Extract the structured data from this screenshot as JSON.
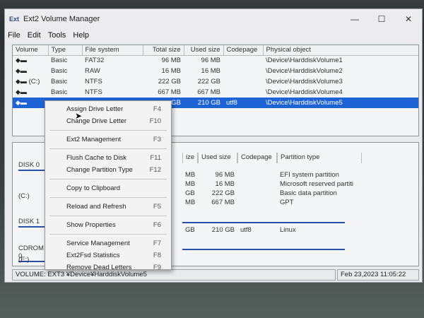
{
  "window": {
    "title": "Ext2 Volume Manager",
    "app_icon": "Ext"
  },
  "window_controls": {
    "minimize": "—",
    "maximize": "☐",
    "close": "✕"
  },
  "menu": [
    "File",
    "Edit",
    "Tools",
    "Help"
  ],
  "volumes": {
    "columns": [
      "Volume",
      "Type",
      "File system",
      "Total size",
      "Used size",
      "Codepage",
      "Physical object"
    ],
    "rows": [
      {
        "volume": "",
        "type": "Basic",
        "fs": "FAT32",
        "total": "96 MB",
        "used": "96 MB",
        "codepage": "",
        "object": "\\Device\\HarddiskVolume1"
      },
      {
        "volume": "",
        "type": "Basic",
        "fs": "RAW",
        "total": "16 MB",
        "used": "16 MB",
        "codepage": "",
        "object": "\\Device\\HarddiskVolume2"
      },
      {
        "volume": "(C:)",
        "type": "Basic",
        "fs": "NTFS",
        "total": "222 GB",
        "used": "222 GB",
        "codepage": "",
        "object": "\\Device\\HarddiskVolume3"
      },
      {
        "volume": "",
        "type": "Basic",
        "fs": "NTFS",
        "total": "667 MB",
        "used": "667 MB",
        "codepage": "",
        "object": "\\Device\\HarddiskVolume4"
      },
      {
        "volume": "",
        "type": "",
        "fs": "",
        "total": "GB",
        "used": "210 GB",
        "codepage": "utf8",
        "object": "\\Device\\HarddiskVolume5"
      }
    ]
  },
  "disks": {
    "header": [
      "ize",
      "Used size",
      "Codepage",
      "Partition type"
    ],
    "labels": [
      "DISK 0",
      "(C:)",
      "DISK 1",
      "CDROM 0",
      "(E:)"
    ],
    "rows": [
      {
        "size": "MB",
        "used": "96 MB",
        "codepage": "",
        "ptype": "EFI system partition"
      },
      {
        "size": "MB",
        "used": "16 MB",
        "codepage": "",
        "ptype": "Microsoft reserved partiti"
      },
      {
        "size": "GB",
        "used": "222 GB",
        "codepage": "",
        "ptype": "Basic data partition"
      },
      {
        "size": "MB",
        "used": "667 MB",
        "codepage": "",
        "ptype": "GPT"
      },
      {
        "size": "GB",
        "used": "210 GB",
        "codepage": "utf8",
        "ptype": "Linux"
      }
    ]
  },
  "context_menu": [
    {
      "label": "Assign Drive Letter",
      "accel": "F4"
    },
    {
      "label": "Change Drive Letter",
      "accel": "F10"
    },
    {
      "sep": true
    },
    {
      "label": "Ext2 Management",
      "accel": "F3"
    },
    {
      "sep": true
    },
    {
      "label": "Flush Cache to Disk",
      "accel": "F11"
    },
    {
      "label": "Change Partition Type",
      "accel": "F12"
    },
    {
      "sep": true
    },
    {
      "label": "Copy to Clipboard",
      "accel": ""
    },
    {
      "sep": true
    },
    {
      "label": "Reload and Refresh",
      "accel": "F5"
    },
    {
      "sep": true
    },
    {
      "label": "Show Properties",
      "accel": "F6"
    },
    {
      "sep": true
    },
    {
      "label": "Service Management",
      "accel": "F7"
    },
    {
      "label": "Ext2Fsd Statistics",
      "accel": "F8"
    },
    {
      "label": "Remove Dead Letters",
      "accel": "F9"
    }
  ],
  "status": {
    "left": "VOLUME:  EXT3 ¥Device¥HarddiskVolume5",
    "right": "Feb 23,2023  11:05:22"
  },
  "colors": {
    "selection": "#1e63d6",
    "accent_line": "#2a4fa8"
  }
}
